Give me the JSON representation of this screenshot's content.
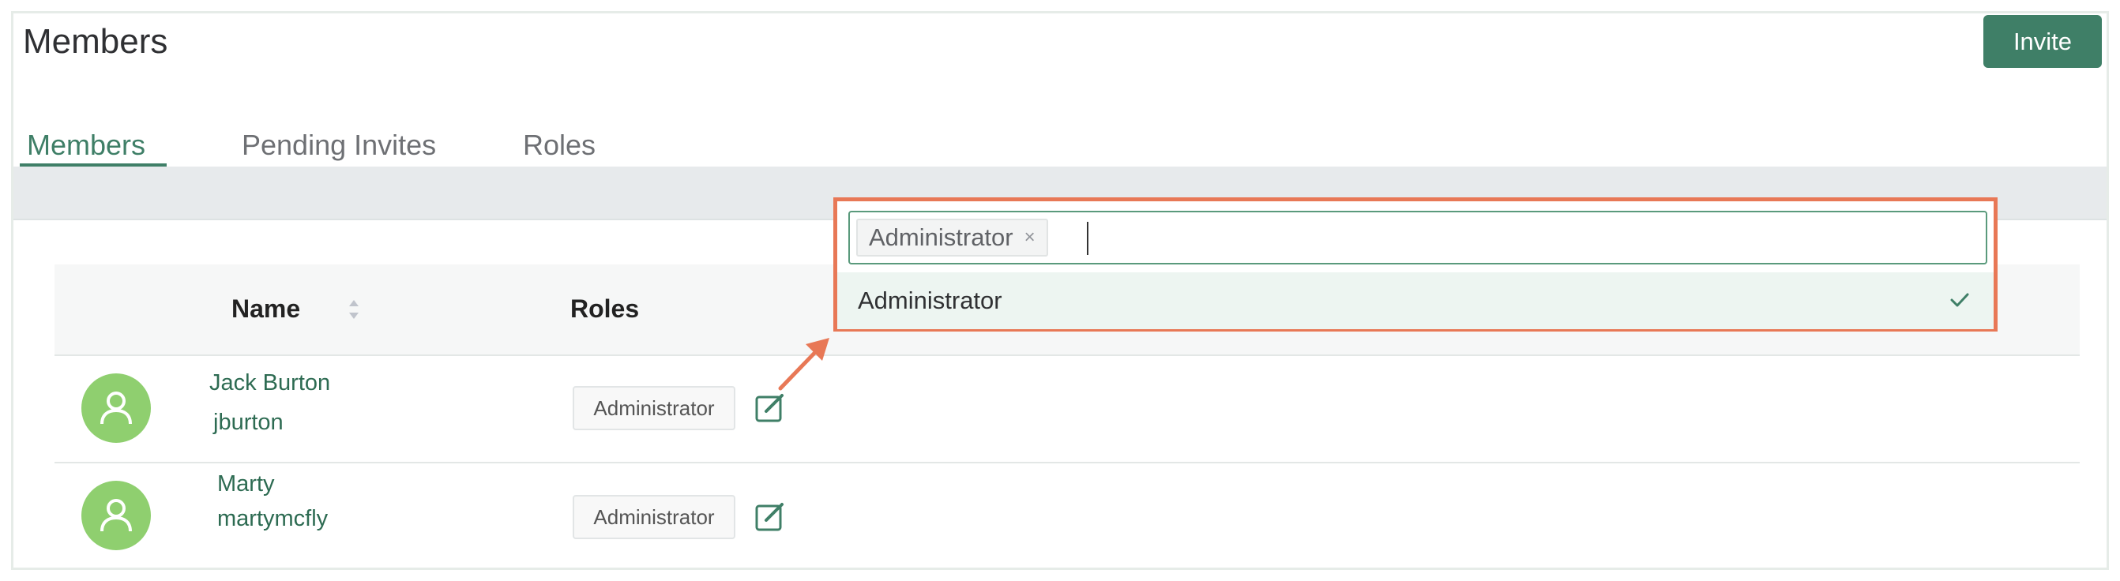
{
  "header": {
    "title": "Members",
    "invite_label": "Invite"
  },
  "tabs": [
    {
      "label": "Members",
      "active": true
    },
    {
      "label": "Pending Invites",
      "active": false
    },
    {
      "label": "Roles",
      "active": false
    }
  ],
  "table": {
    "columns": {
      "name": "Name",
      "roles": "Roles"
    },
    "rows": [
      {
        "display_name": "Jack Burton",
        "username": "jburton",
        "role": "Administrator"
      },
      {
        "display_name": "Marty",
        "username": "martymcfly",
        "role": "Administrator"
      }
    ]
  },
  "role_dropdown": {
    "selected_tag": "Administrator",
    "tag_close_glyph": "×",
    "options": [
      {
        "label": "Administrator",
        "selected": true
      }
    ]
  },
  "colors": {
    "accent": "#3f7f67",
    "highlight": "#e87856",
    "avatar": "#8fcf6f"
  },
  "icons": {
    "avatar": "user-icon",
    "sort": "sort-icon",
    "edit": "edit-icon",
    "check": "check-icon"
  }
}
